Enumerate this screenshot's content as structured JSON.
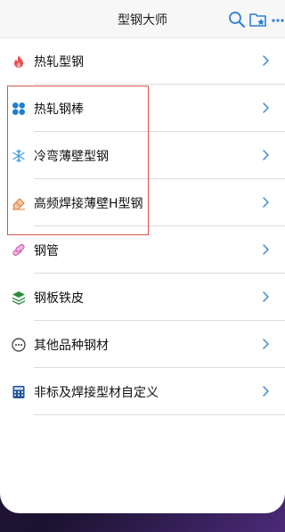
{
  "header": {
    "title": "型钢大师"
  },
  "list": {
    "items": [
      {
        "label": "热轧型钢",
        "icon": "flame-icon"
      },
      {
        "label": "热轧钢棒",
        "icon": "four-circles-icon"
      },
      {
        "label": "冷弯薄壁型钢",
        "icon": "snowflake-icon"
      },
      {
        "label": "高频焊接薄壁H型钢",
        "icon": "eraser-icon"
      },
      {
        "label": "钢管",
        "icon": "pipes-icon"
      },
      {
        "label": "钢板铁皮",
        "icon": "layers-icon"
      },
      {
        "label": "其他品种钢材",
        "icon": "ellipsis-circle-icon"
      },
      {
        "label": "非标及焊接型材自定义",
        "icon": "calculator-icon"
      }
    ]
  },
  "colors": {
    "chevron": "#3b8bd6",
    "highlight_border": "#d9534f",
    "flame": "#e94f4f",
    "blue_icon": "#1f7fd1",
    "green_icon": "#2e8b3a"
  }
}
